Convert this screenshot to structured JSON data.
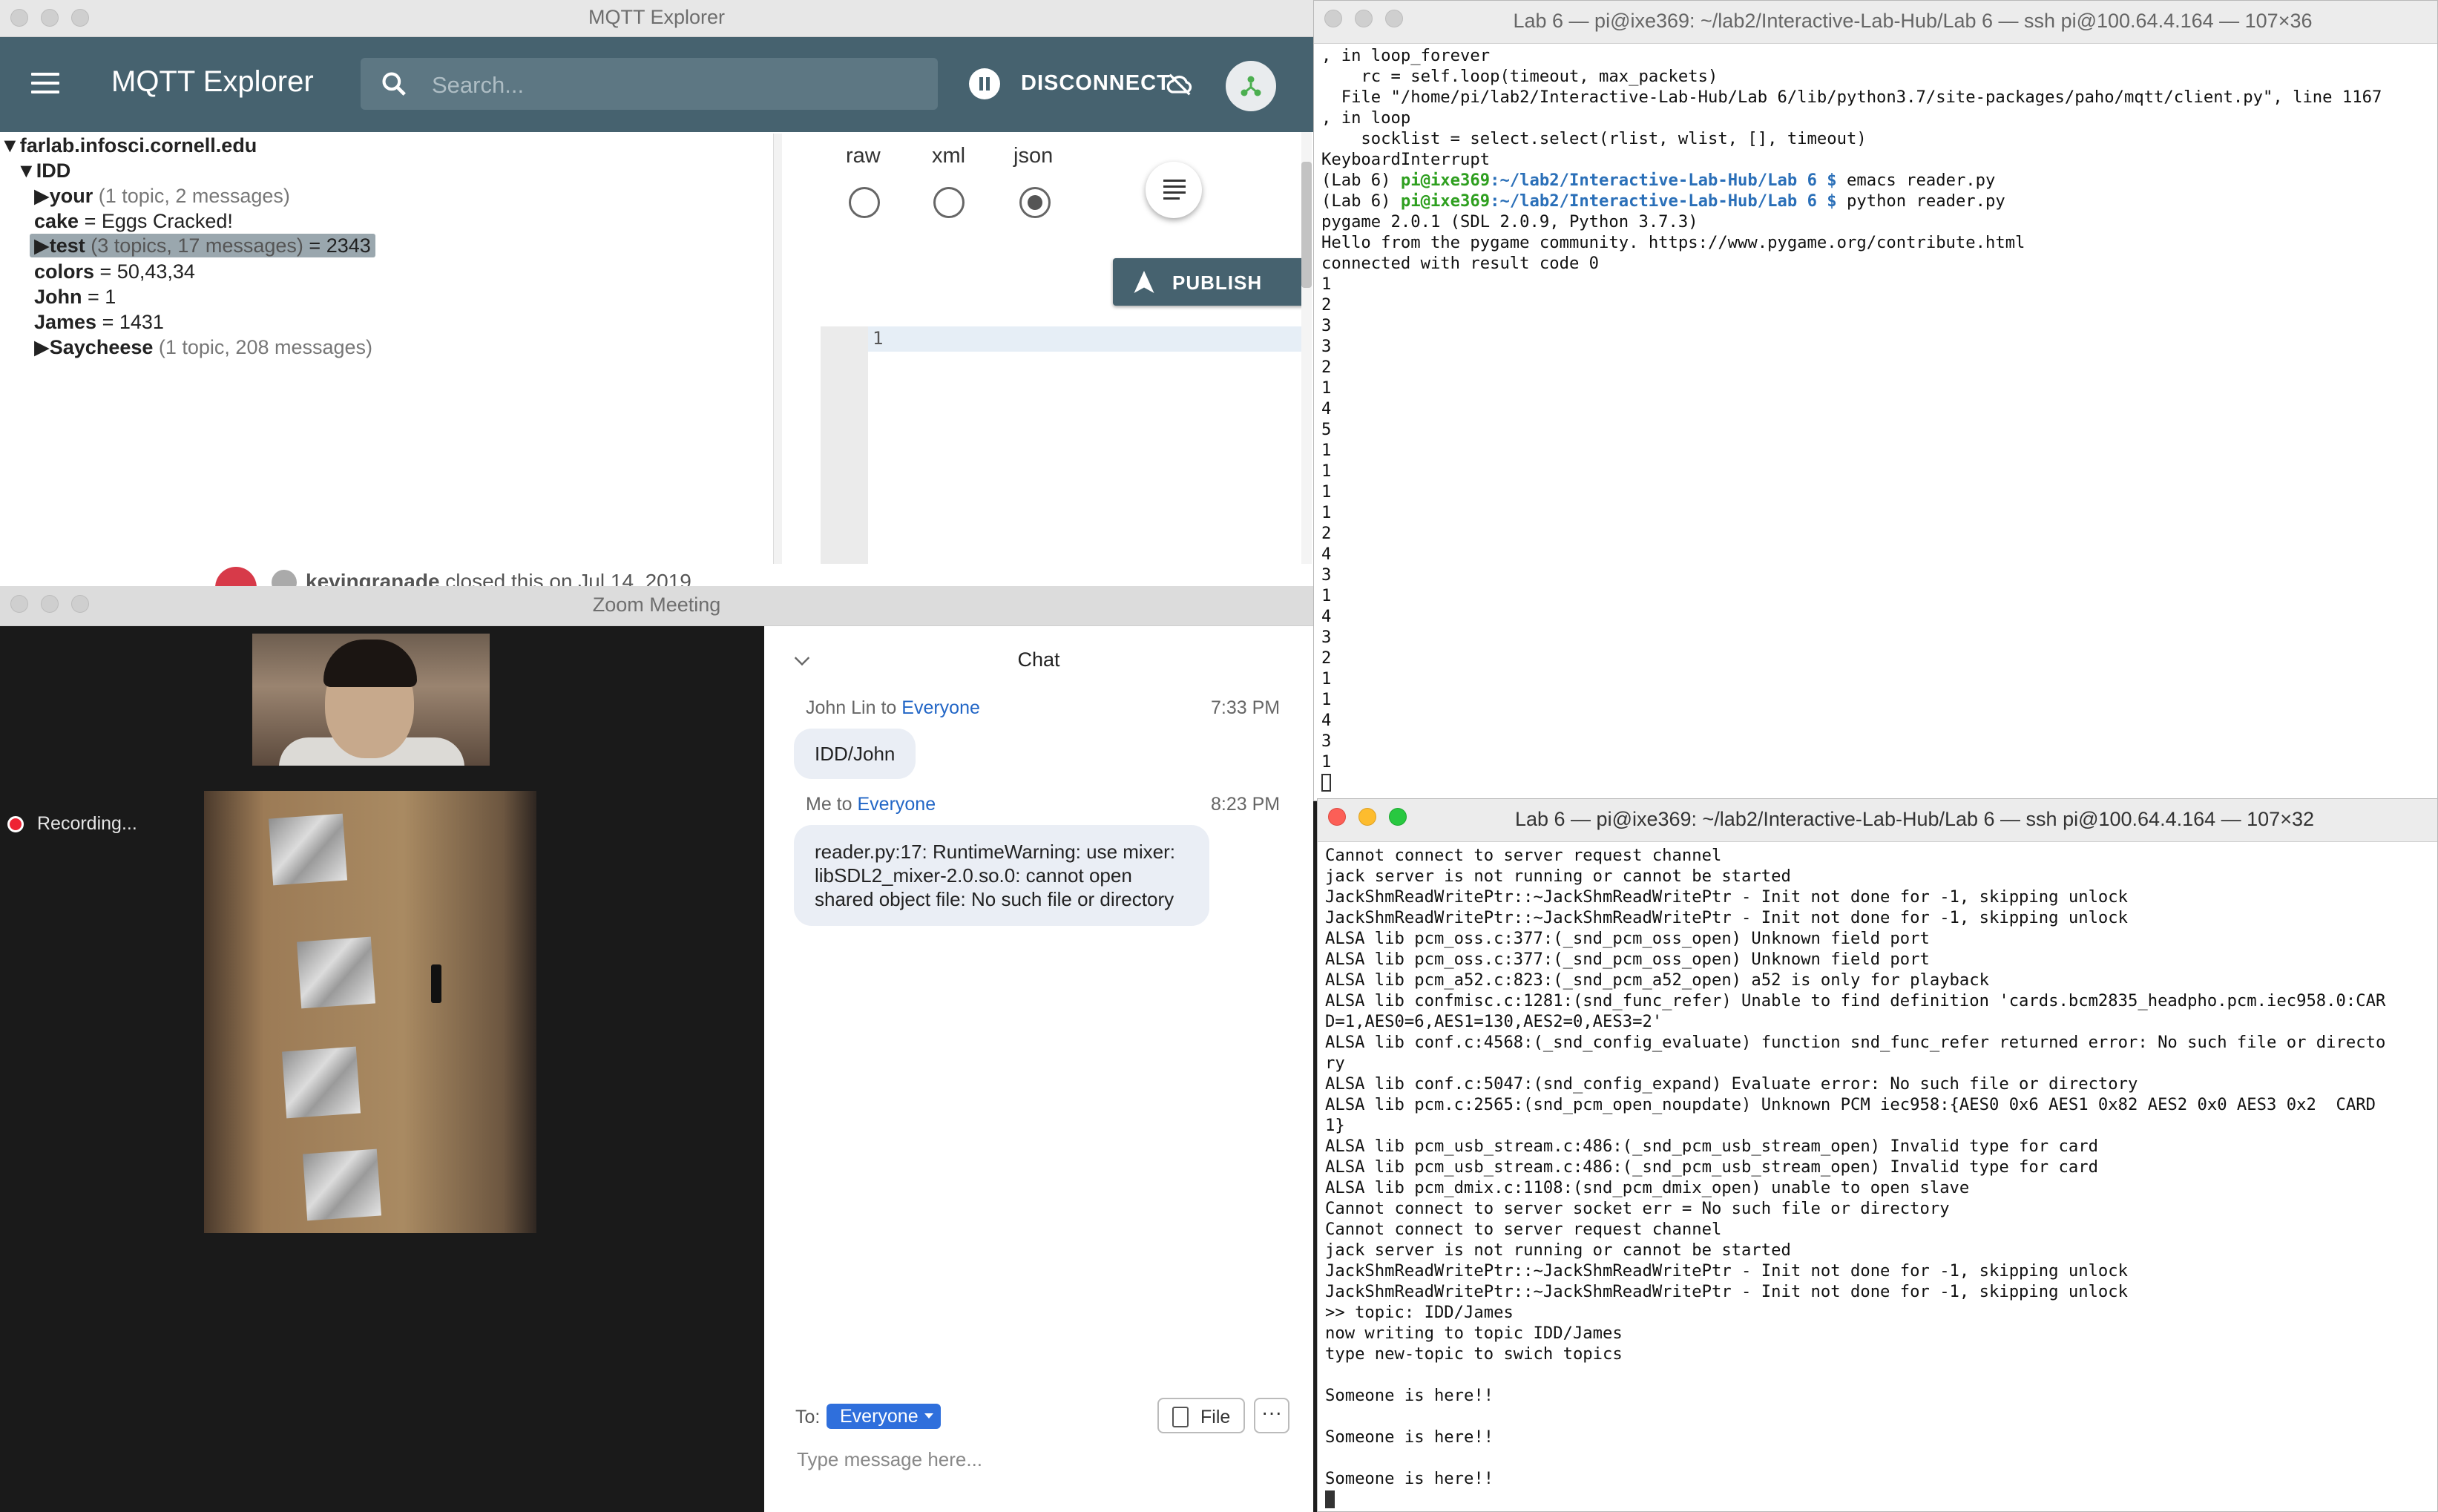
{
  "mqtt": {
    "window_title": "MQTT Explorer",
    "app_title": "MQTT Explorer",
    "search_placeholder": "Search...",
    "disconnect_label": "DISCONNECT",
    "tree": [
      {
        "key": "farlab.infosci.cornell.edu",
        "meta": "",
        "value": "",
        "arrow": "▼"
      },
      {
        "key": "IDD",
        "meta": "",
        "value": "",
        "arrow": "▼"
      },
      {
        "key": "your",
        "meta": " (1 topic, 2 messages)",
        "value": "",
        "arrow": "▶"
      },
      {
        "key": "cake",
        "meta": "",
        "value": " = Eggs Cracked!",
        "arrow": ""
      },
      {
        "key": "test",
        "meta": " (3 topics, 17 messages)",
        "value": " = 2343",
        "arrow": "▶"
      },
      {
        "key": "colors",
        "meta": "",
        "value": " = 50,43,34",
        "arrow": ""
      },
      {
        "key": "John",
        "meta": "",
        "value": " = 1",
        "arrow": ""
      },
      {
        "key": "James",
        "meta": "",
        "value": " = 1431",
        "arrow": ""
      },
      {
        "key": "Saycheese",
        "meta": " (1 topic, 208 messages)",
        "value": "",
        "arrow": "▶"
      }
    ],
    "formats": [
      "raw",
      "xml",
      "json"
    ],
    "selected_format": "json",
    "publish_label": "PUBLISH",
    "editor_line": "1"
  },
  "github_sliver": {
    "user": "kevingranade",
    "text": " closed this on Jul 14, 2019"
  },
  "zoom": {
    "window_title": "Zoom Meeting",
    "recording_label": "Recording...",
    "chat_title": "Chat",
    "messages": [
      {
        "from": "John Lin to ",
        "to": "Everyone",
        "time": "7:33 PM",
        "text": "IDD/John"
      },
      {
        "from": "Me to ",
        "to": "Everyone",
        "time": "8:23 PM",
        "text": "reader.py:17: RuntimeWarning: use mixer: libSDL2_mixer-2.0.so.0: cannot open shared object file: No such file or directory"
      }
    ],
    "to_label": "To:",
    "to_value": "Everyone",
    "file_label": "File",
    "more_label": "···",
    "input_placeholder": "Type message here..."
  },
  "term1": {
    "title": "Lab 6 — pi@ixe369: ~/lab2/Interactive-Lab-Hub/Lab 6 — ssh pi@100.64.4.164 — 107×36",
    "lines_before": ", in loop_forever\n    rc = self.loop(timeout, max_packets)\n  File \"/home/pi/lab2/Interactive-Lab-Hub/Lab 6/lib/python3.7/site-packages/paho/mqtt/client.py\", line 1167\n, in loop\n    socklist = select.select(rlist, wlist, [], timeout)\nKeyboardInterrupt",
    "prompt_env": "(Lab 6) ",
    "prompt_host": "pi@ixe369",
    "prompt_path": ":~/lab2/Interactive-Lab-Hub/Lab 6 $ ",
    "cmd1": "emacs reader.py",
    "cmd2": "python reader.py",
    "lines_after": "pygame 2.0.1 (SDL 2.0.9, Python 3.7.3)\nHello from the pygame community. https://www.pygame.org/contribute.html\nconnected with result code 0\n1\n2\n3\n3\n2\n1\n4\n5\n1\n1\n1\n1\n2\n4\n3\n1\n4\n3\n2\n1\n1\n4\n3\n1"
  },
  "term2": {
    "title": "Lab 6 — pi@ixe369: ~/lab2/Interactive-Lab-Hub/Lab 6 — ssh pi@100.64.4.164 — 107×32",
    "output": "Cannot connect to server request channel\njack server is not running or cannot be started\nJackShmReadWritePtr::~JackShmReadWritePtr - Init not done for -1, skipping unlock\nJackShmReadWritePtr::~JackShmReadWritePtr - Init not done for -1, skipping unlock\nALSA lib pcm_oss.c:377:(_snd_pcm_oss_open) Unknown field port\nALSA lib pcm_oss.c:377:(_snd_pcm_oss_open) Unknown field port\nALSA lib pcm_a52.c:823:(_snd_pcm_a52_open) a52 is only for playback\nALSA lib confmisc.c:1281:(snd_func_refer) Unable to find definition 'cards.bcm2835_headpho.pcm.iec958.0:CAR\nD=1,AES0=6,AES1=130,AES2=0,AES3=2'\nALSA lib conf.c:4568:(_snd_config_evaluate) function snd_func_refer returned error: No such file or directo\nry\nALSA lib conf.c:5047:(snd_config_expand) Evaluate error: No such file or directory\nALSA lib pcm.c:2565:(snd_pcm_open_noupdate) Unknown PCM iec958:{AES0 0x6 AES1 0x82 AES2 0x0 AES3 0x2  CARD\n1}\nALSA lib pcm_usb_stream.c:486:(_snd_pcm_usb_stream_open) Invalid type for card\nALSA lib pcm_usb_stream.c:486:(_snd_pcm_usb_stream_open) Invalid type for card\nALSA lib pcm_dmix.c:1108:(snd_pcm_dmix_open) unable to open slave\nCannot connect to server socket err = No such file or directory\nCannot connect to server request channel\njack server is not running or cannot be started\nJackShmReadWritePtr::~JackShmReadWritePtr - Init not done for -1, skipping unlock\nJackShmReadWritePtr::~JackShmReadWritePtr - Init not done for -1, skipping unlock\n>> topic: IDD/James\nnow writing to topic IDD/James\ntype new-topic to swich topics\n\nSomeone is here!!\n\nSomeone is here!!\n\nSomeone is here!!"
  },
  "colors": {
    "mqtt_appbar": "#46626f",
    "zoom_link": "#2266c6",
    "prompt_host": "#2e9f1f",
    "prompt_path": "#2a6fb8"
  }
}
